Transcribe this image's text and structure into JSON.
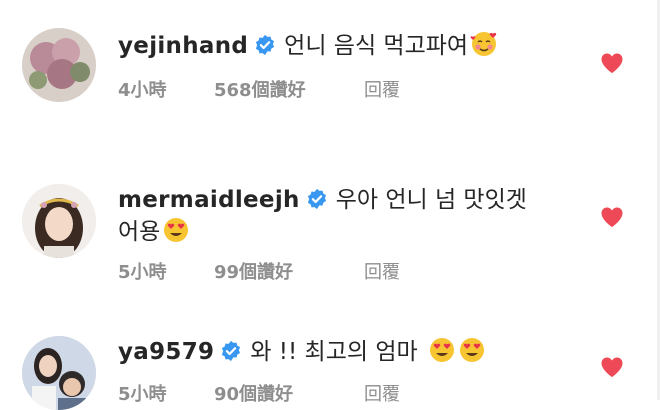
{
  "comments": [
    {
      "username": "yejinhand",
      "text": "언니 음식 먹고파여",
      "time": "4小時",
      "likes": "568個讚好",
      "reply": "回覆"
    },
    {
      "username": "mermaidleejh",
      "text_line1": "우아 언니 넘 맛잇겟",
      "text_line2": "어용",
      "time": "5小時",
      "likes": "99個讚好",
      "reply": "回覆"
    },
    {
      "username": "ya9579",
      "text": "와 !! 최고의 엄마",
      "time": "5小時",
      "likes": "90個讚好",
      "reply": "回覆"
    }
  ],
  "colors": {
    "verified": "#3897f0",
    "heart": "#ed4956",
    "meta": "#8e8e8e"
  },
  "icons": [
    "verified-badge-icon",
    "heart-icon",
    "smiling-face-with-hearts-emoji",
    "heart-eyes-emoji"
  ]
}
